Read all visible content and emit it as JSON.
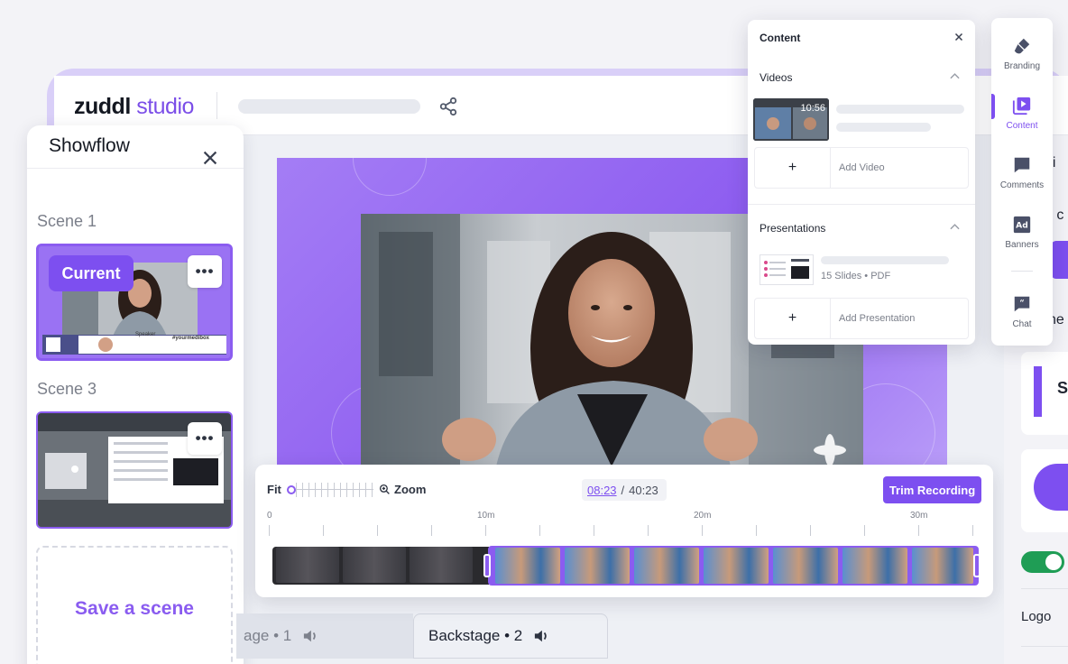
{
  "app": {
    "brand_bold": "zuddl",
    "brand_light": " studio"
  },
  "showflow": {
    "title": "Showflow",
    "scenes": [
      {
        "label": "Scene 1",
        "badge": "Current",
        "lower_third_name": "Speaker",
        "lower_third_hashtag": "#yourmedibox"
      },
      {
        "label": "Scene 3"
      }
    ],
    "save_scene": "Save a scene"
  },
  "stages": [
    {
      "label": "age • 1"
    },
    {
      "label": "Backstage • 2"
    }
  ],
  "timeline": {
    "fit": "Fit",
    "zoom": "Zoom",
    "current_time": "08:23",
    "separator": "/",
    "total_time": "40:23",
    "trim_button": "Trim Recording",
    "ticks": [
      "0",
      "10m",
      "20m",
      "30m"
    ]
  },
  "content_panel": {
    "title": "Content",
    "videos_heading": "Videos",
    "video_duration": "10:56",
    "add_video": "Add Video",
    "presentations_heading": "Presentations",
    "presentation_meta": "15 Slides • PDF",
    "add_presentation": "Add Presentation"
  },
  "rail": {
    "items": [
      {
        "label": "Branding",
        "icon": "paintbrush-icon"
      },
      {
        "label": "Content",
        "icon": "play-library-icon"
      },
      {
        "label": "Comments",
        "icon": "comment-icon"
      },
      {
        "label": "Banners",
        "icon": "ad-icon"
      },
      {
        "label": "Chat",
        "icon": "chat-quote-icon"
      }
    ]
  },
  "right_panel": {
    "fragment1": "di",
    "fragment2": "d c",
    "fragment3": "ne",
    "fragment4": "S",
    "logo": "Logo"
  },
  "colors": {
    "accent": "#7d4ff0",
    "toggle_on": "#1f9d55",
    "ink": "#141821"
  }
}
